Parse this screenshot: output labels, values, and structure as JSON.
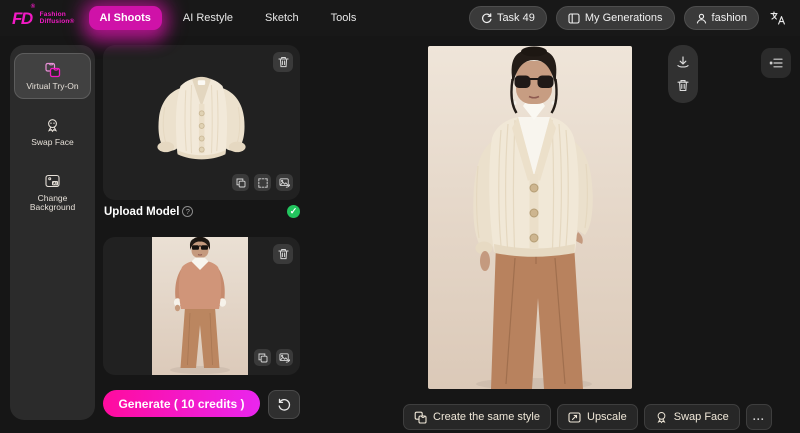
{
  "navbar": {
    "logo_glyph": "FD",
    "logo_reg": "®",
    "logo_line1": "Fashion",
    "logo_line2": "Diffusion®",
    "items": [
      {
        "label": "AI Shoots",
        "active": true
      },
      {
        "label": "AI Restyle",
        "active": false
      },
      {
        "label": "Sketch",
        "active": false
      },
      {
        "label": "Tools",
        "active": false
      }
    ],
    "task_button_label": "Task 49",
    "my_generations_label": "My Generations",
    "account_label": "fashion"
  },
  "sidebar": {
    "items": [
      {
        "label": "Virtual Try-On",
        "active": true
      },
      {
        "label": "Swap Face",
        "active": false
      },
      {
        "label": "Change Background",
        "active": false
      }
    ]
  },
  "upload": {
    "model_section_label": "Upload Model",
    "help_glyph": "?",
    "ready_glyph": "✓"
  },
  "generate": {
    "label": "Generate ( 10 credits )"
  },
  "result_actions": {
    "create_same_style_label": "Create the same style",
    "upscale_label": "Upscale",
    "swap_face_label": "Swap Face",
    "more_label": "..."
  },
  "icons": {
    "navbar": [
      "refresh-icon",
      "collection-icon",
      "person-icon",
      "translate-icon"
    ],
    "sidebar": [
      "try-on-garments-icon",
      "face-badge-icon",
      "background-ai-icon"
    ],
    "thumbnails": [
      "trash-icon",
      "copy-icon",
      "crop-marquee-icon",
      "replace-image-icon"
    ],
    "preview": [
      "download-icon",
      "trash-icon",
      "panel-toggle-icon"
    ],
    "actions": [
      "copy-style-icon",
      "upscale-icon",
      "face-badge-icon",
      "ellipsis"
    ]
  },
  "colors": {
    "accent_pink": "#f21ac4",
    "generate_gradient_start": "#ff0b9e",
    "generate_gradient_end": "#e926ee",
    "success_green": "#22c55e",
    "page_background": "#161616",
    "panel_background": "#212121",
    "photo_background": "#e9ddd0",
    "garment_cream": "#f1e8d7",
    "trouser_tan": "#b8825e"
  }
}
